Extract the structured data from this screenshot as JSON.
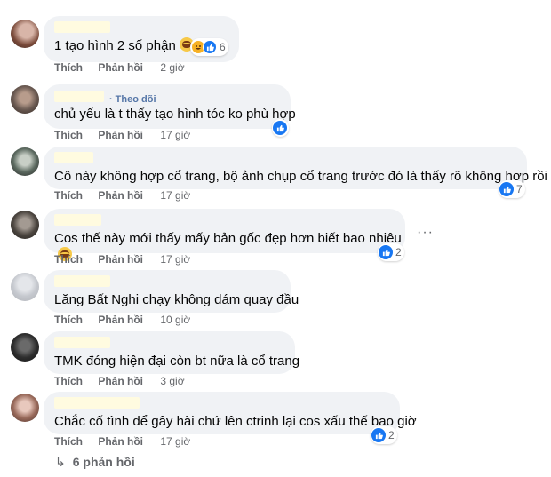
{
  "comments": [
    {
      "text": "1 tạo hình 2 số phận",
      "emoji": "grin-emoji",
      "reactions": "6",
      "reaction_types": [
        "like",
        "haha"
      ],
      "actions": {
        "like": "Thích",
        "reply": "Phản hồi",
        "time": "2 giờ"
      }
    },
    {
      "follow": "Theo dõi",
      "text": "chủ yếu là t thấy tạo hình tóc ko phù hợp",
      "reactions": "",
      "reaction_types": [
        "like"
      ],
      "actions": {
        "like": "Thích",
        "reply": "Phản hồi",
        "time": "17 giờ"
      }
    },
    {
      "text": "Cô này không hợp cổ trang, bộ ảnh chụp cổ trang trước đó là thấy rõ không hợp rồi",
      "reactions": "7",
      "reaction_types": [
        "like"
      ],
      "actions": {
        "like": "Thích",
        "reply": "Phản hồi",
        "time": "17 giờ"
      }
    },
    {
      "text": "Cos thế này mới thấy mấy bản gốc đẹp hơn biết bao nhiêu",
      "emoji": "laugh-emoji",
      "reactions": "2",
      "reaction_types": [
        "like"
      ],
      "actions": {
        "like": "Thích",
        "reply": "Phản hồi",
        "time": "17 giờ"
      }
    },
    {
      "text": "Lăng Bất Nghi chạy không dám quay đầu",
      "actions": {
        "like": "Thích",
        "reply": "Phản hồi",
        "time": "10 giờ"
      }
    },
    {
      "text": "TMK đóng hiện đại còn bt nữa là cổ trang",
      "actions": {
        "like": "Thích",
        "reply": "Phản hồi",
        "time": "3 giờ"
      }
    },
    {
      "text": "Chắc cố tình để gây hài chứ lên ctrinh lại cos xấu thế bao giờ",
      "reactions": "2",
      "reaction_types": [
        "like"
      ],
      "actions": {
        "like": "Thích",
        "reply": "Phản hồi",
        "time": "17 giờ"
      }
    }
  ],
  "more_icon": "more-dots-icon",
  "replies_link": "6 phản hồi",
  "colors": {
    "bubble": "#f0f2f5",
    "like_blue": "#1877f2",
    "secondary_text": "#65676b",
    "follow_link": "#5677a8",
    "name_highlight": "#fffbe0"
  }
}
